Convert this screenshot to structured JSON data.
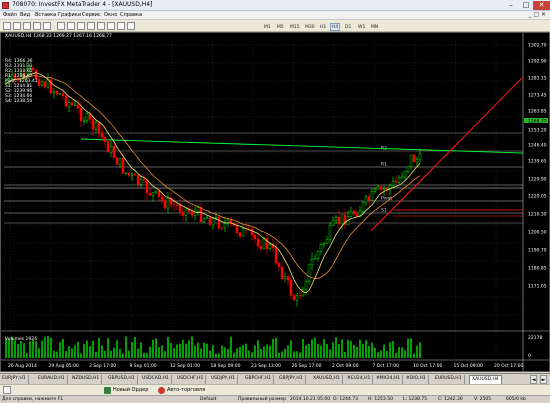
{
  "window": {
    "title": "708070: InvestFX MetaTrader 4 - [XAUUSD,H4]",
    "controls": {
      "minimize": "–",
      "maximize": "□",
      "close": "✕"
    }
  },
  "menu": {
    "items": [
      "Файл",
      "Вид",
      "Вставка",
      "Графики",
      "Сервис",
      "Окно",
      "Справка"
    ],
    "mdi": "_ □ ✕"
  },
  "toolbar": {
    "timeframes": [
      "M1",
      "M5",
      "M15",
      "M30",
      "H1",
      "H4",
      "D1",
      "W1",
      "MN"
    ],
    "active_timeframe": "H4"
  },
  "chart": {
    "header": "XAUUSD,H4  1268.33 1269.27 1267.16 1268.77",
    "background": "#000000",
    "bull_color": "#00ff00",
    "bear_color": "#ff0000",
    "ma_color": "#e8e879",
    "indicator_levels": [
      "R4: 1366.36",
      "R3: 1331.31",
      "R2: 1310.65",
      "R1: 1288.97",
      "Pivot: 1263.41",
      "S1: 1244.81",
      "S2: 1239.96",
      "S3: 1234.66",
      "S4: 1238.56"
    ],
    "price_ticks": [
      "1302.70",
      "1292.90",
      "1283.15",
      "1273.45",
      "1263.85",
      "1268.77",
      "1253.20",
      "1246.40",
      "1239.65",
      "1229.90",
      "1220.05",
      "1210.30",
      "1200.50",
      "1190.70",
      "1180.85",
      "1171.05"
    ],
    "pivot_labels": [
      "R2",
      "R1",
      "Pivot",
      "S1"
    ],
    "volume_header": "Volumes 1924",
    "volume_max": "22178",
    "volume_min": "0",
    "time_labels": [
      "26 Aug 2014",
      "29 Aug 05:00",
      "3 Sep 17:00",
      "9 Sep 01:00",
      "12 Sep 01:00",
      "18 Sep 09:00",
      "23 Sep 13:00",
      "26 Sep 17:00",
      "2 Oct 09:00",
      "7 Oct 17:00",
      "10 Oct 17:00",
      "15 Oct 09:00",
      "20 Oct 17:00"
    ]
  },
  "tabs": {
    "symbols": [
      "EURJPY,H1",
      "EURAUD,H1",
      "NZDUSD,H1",
      "GBPUSD,H1",
      "USDCAD,H1",
      "USDCHF,H1",
      "USDJPY,H1",
      "GBPCHF,H1",
      "GBPJPY,H1",
      "XAUUSD,H1",
      "#EU24,H1",
      "#MX24,H1",
      "#DIO,H1",
      "EURUSD,H1",
      "XAUUSD,H4"
    ],
    "active": "XAUUSD,H4",
    "left_arrow": "◄",
    "right_arrow": "►"
  },
  "tradebar": {
    "new_order": "Новый Ордер",
    "autotrading": "Авто-торговля"
  },
  "status": {
    "help": "Для справки, нажмите F1",
    "profile": "Default",
    "template": "Правильный размер",
    "datetime": "2014.10.21 05:00",
    "open": "O: 1244.73",
    "high": "H: 1253.50",
    "low": "L: 1238.75",
    "close": "C: 1242.30",
    "volume": "V: 2505",
    "traffic": "605/0 kb"
  }
}
